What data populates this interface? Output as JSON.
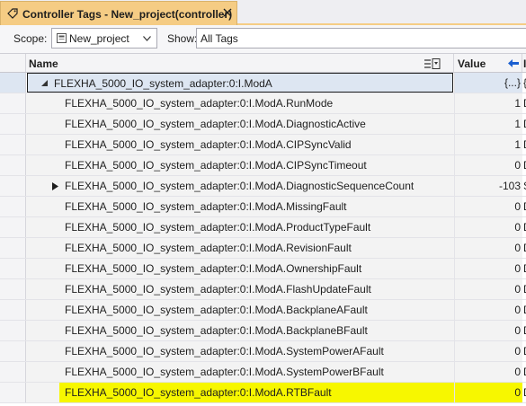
{
  "tab": {
    "title": "Controller Tags - New_project(controller)"
  },
  "toolbar": {
    "scope_label": "Scope:",
    "scope_value": "New_project",
    "show_label": "Show:",
    "show_value": "All Tags"
  },
  "columns": {
    "name": "Name",
    "value": "Value",
    "extra": "I"
  },
  "parent_row": {
    "name": "FLEXHA_5000_IO_system_adapter:0:I.ModA",
    "value": "{...}",
    "extra": "{"
  },
  "rows": [
    {
      "name": "FLEXHA_5000_IO_system_adapter:0:I.ModA.RunMode",
      "value": "1",
      "extra": "D"
    },
    {
      "name": "FLEXHA_5000_IO_system_adapter:0:I.ModA.DiagnosticActive",
      "value": "1",
      "extra": "D"
    },
    {
      "name": "FLEXHA_5000_IO_system_adapter:0:I.ModA.CIPSyncValid",
      "value": "1",
      "extra": "D"
    },
    {
      "name": "FLEXHA_5000_IO_system_adapter:0:I.ModA.CIPSyncTimeout",
      "value": "0",
      "extra": "D"
    },
    {
      "name": "FLEXHA_5000_IO_system_adapter:0:I.ModA.DiagnosticSequenceCount",
      "value": "-103",
      "extra": "S"
    },
    {
      "name": "FLEXHA_5000_IO_system_adapter:0:I.ModA.MissingFault",
      "value": "0",
      "extra": "D"
    },
    {
      "name": "FLEXHA_5000_IO_system_adapter:0:I.ModA.ProductTypeFault",
      "value": "0",
      "extra": "D"
    },
    {
      "name": "FLEXHA_5000_IO_system_adapter:0:I.ModA.RevisionFault",
      "value": "0",
      "extra": "D"
    },
    {
      "name": "FLEXHA_5000_IO_system_adapter:0:I.ModA.OwnershipFault",
      "value": "0",
      "extra": "D"
    },
    {
      "name": "FLEXHA_5000_IO_system_adapter:0:I.ModA.FlashUpdateFault",
      "value": "0",
      "extra": "D"
    },
    {
      "name": "FLEXHA_5000_IO_system_adapter:0:I.ModA.BackplaneAFault",
      "value": "0",
      "extra": "D"
    },
    {
      "name": "FLEXHA_5000_IO_system_adapter:0:I.ModA.BackplaneBFault",
      "value": "0",
      "extra": "D"
    },
    {
      "name": "FLEXHA_5000_IO_system_adapter:0:I.ModA.SystemPowerAFault",
      "value": "0",
      "extra": "D"
    },
    {
      "name": "FLEXHA_5000_IO_system_adapter:0:I.ModA.SystemPowerBFault",
      "value": "0",
      "extra": "D"
    },
    {
      "name": "FLEXHA_5000_IO_system_adapter:0:I.ModA.RTBFault",
      "value": "0",
      "extra": "D"
    }
  ],
  "icons": {
    "tab": "tag-icon",
    "close": "close-icon",
    "scope": "project-icon",
    "dropdown": "chevron-down-icon",
    "filter": "column-filter-icon",
    "sort": "sort-arrow-icon",
    "collapse": "collapse-triangle-icon",
    "expand": "expand-triangle-icon"
  },
  "colors": {
    "tab_active": "#f5cc84",
    "row_highlight": "#f7f700",
    "selected_row": "#dde6f2",
    "accent_arrow": "#1a5fd1"
  }
}
